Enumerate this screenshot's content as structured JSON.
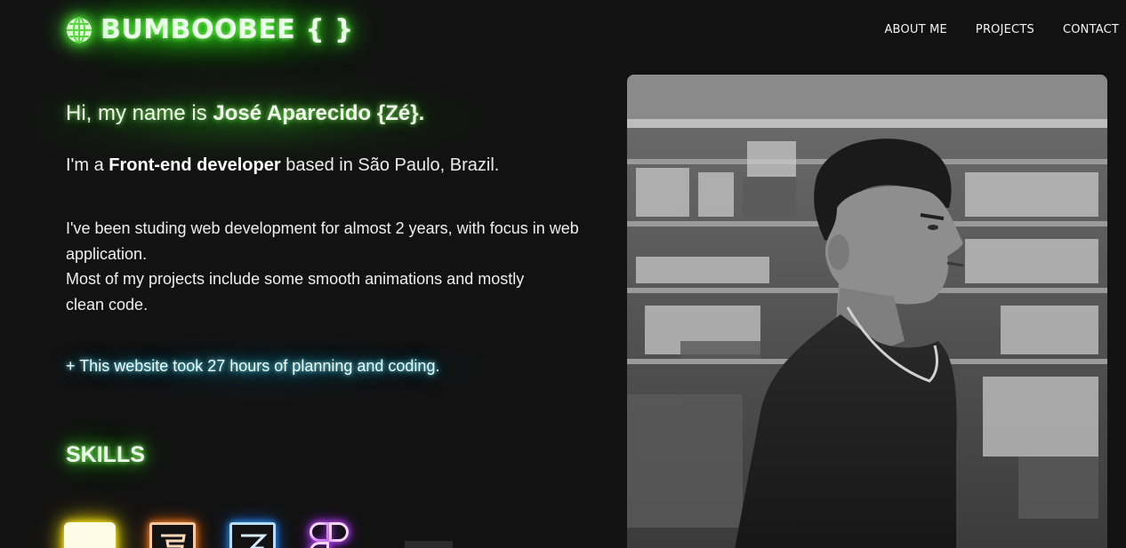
{
  "header": {
    "brand": "BUMBOOBEE { }",
    "nav": [
      "ABOUT ME",
      "PROJECTS",
      "CONTACT"
    ]
  },
  "intro": {
    "greeting_prefix": "Hi, my name is ",
    "greeting_name": "José Aparecido {Zé}.",
    "role_prefix": "I'm a ",
    "role_title": "Front-end developer",
    "role_suffix": " based in São Paulo, Brazil.",
    "bio_line1": "I've been studing web development for almost 2 years, with focus in web application.",
    "bio_line2": "Most of my projects include some smooth animations and mostly clean code.",
    "note": "+ This website took 27 hours of planning and coding."
  },
  "skills": {
    "title": "SKILLS",
    "icons": [
      "javascript-icon",
      "html5-icon",
      "css3-icon",
      "figma-icon"
    ]
  },
  "colors": {
    "background": "#121212",
    "glow_green": "#3fe62a",
    "glow_cyan": "#3cc8e6",
    "js_yellow": "#ffee33",
    "html_orange": "#ff8a33",
    "css_blue": "#3399ff",
    "figma_purple": "#cc55ff"
  }
}
